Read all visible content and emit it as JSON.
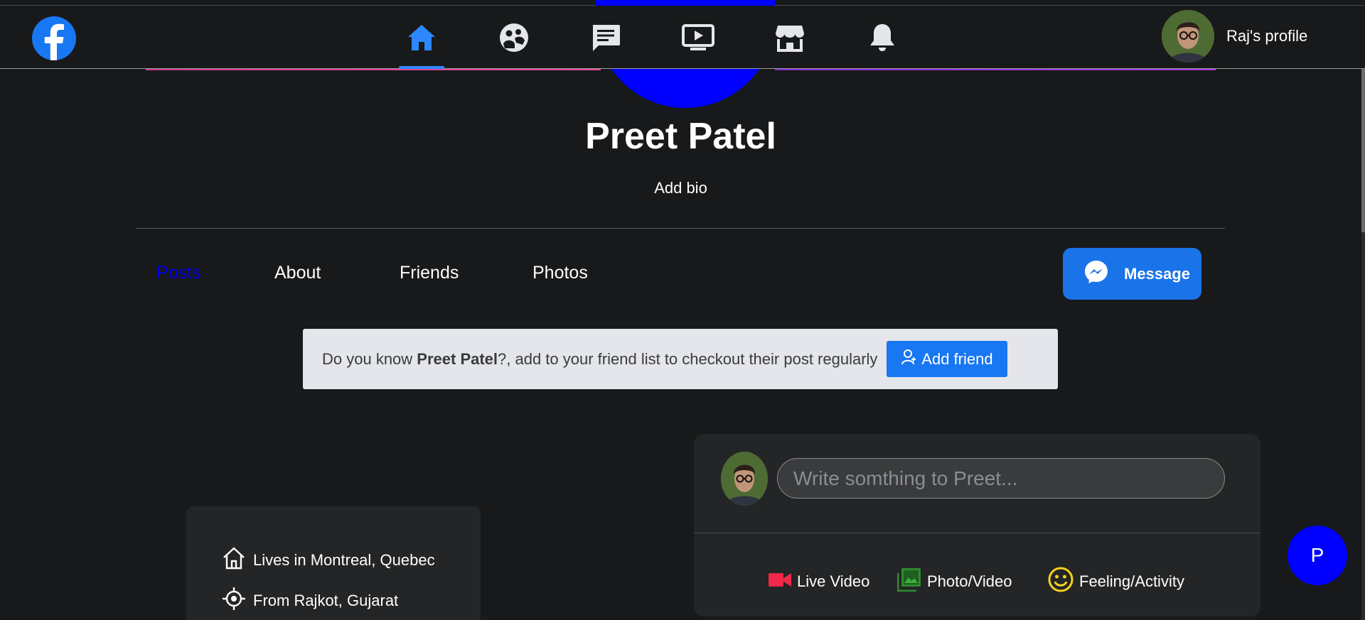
{
  "colors": {
    "background": "#18191a",
    "card": "#242526",
    "accent": "#1877f2",
    "active_tab": "#0000ee",
    "profile_pic": "#0000ff",
    "live_video": "#f02849",
    "photo_video": "#2e8b2e",
    "feeling": "#f7d21e"
  },
  "navbar": {
    "logo_icon": "facebook-logo-icon",
    "icons": [
      "home-icon",
      "groups-icon",
      "messages-icon",
      "watch-icon",
      "marketplace-icon",
      "notifications-icon"
    ],
    "active_icon": "home-icon",
    "profile": {
      "name": "Raj's profile"
    }
  },
  "profile": {
    "name": "Preet Patel",
    "bio": "Add bio"
  },
  "tabs": [
    {
      "label": "Posts",
      "active": true
    },
    {
      "label": "About",
      "active": false
    },
    {
      "label": "Friends",
      "active": false
    },
    {
      "label": "Photos",
      "active": false
    }
  ],
  "message_button": {
    "label": "Message",
    "icon": "messenger-icon"
  },
  "know_box": {
    "prefix": "Do you know ",
    "name": "Preet Patel",
    "suffix": "?, add to your friend list to checkout their post regularly",
    "button_label": "Add friend",
    "button_icon": "user-icon"
  },
  "intro": [
    {
      "icon": "house-icon",
      "text": "Lives in Montreal, Quebec"
    },
    {
      "icon": "location-icon",
      "text": "From Rajkot, Gujarat"
    }
  ],
  "composer": {
    "placeholder": "Write somthing to Preet...",
    "actions": [
      {
        "icon": "video-camera-icon",
        "label": "Live Video"
      },
      {
        "icon": "photo-icon",
        "label": "Photo/Video"
      },
      {
        "icon": "smiley-icon",
        "label": "Feeling/Activity"
      }
    ]
  },
  "chat_bubble": {
    "initial": "P"
  }
}
